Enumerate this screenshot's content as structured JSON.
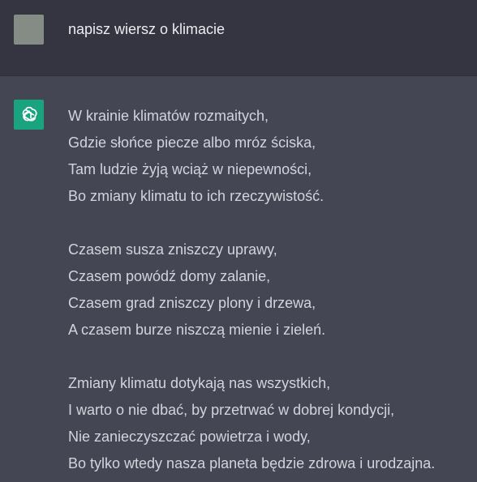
{
  "user_message": {
    "text": "napisz wiersz o klimacie"
  },
  "assistant_message": {
    "icon": "openai-logo-icon",
    "stanzas": [
      [
        "W krainie klimatów rozmaitych,",
        "Gdzie słońce piecze albo mróz ściska,",
        "Tam ludzie żyją wciąż w niepewności,",
        "Bo zmiany klimatu to ich rzeczywistość."
      ],
      [
        "Czasem susza zniszczy uprawy,",
        "Czasem powódź domy zalanie,",
        "Czasem grad zniszczy plony i drzewa,",
        "A czasem burze niszczą mienie i zieleń."
      ],
      [
        "Zmiany klimatu dotykają nas wszystkich,",
        "I warto o nie dbać, by przetrwać w dobrej kondycji,",
        "Nie zanieczyszczać powietrza i wody,",
        "Bo tylko wtedy nasza planeta będzie zdrowa i urodzajna."
      ]
    ]
  },
  "colors": {
    "user_bg": "#343541",
    "assistant_bg": "#444654",
    "assistant_avatar": "#19a37f",
    "user_avatar": "#848c85",
    "text": "#d1d5db"
  }
}
